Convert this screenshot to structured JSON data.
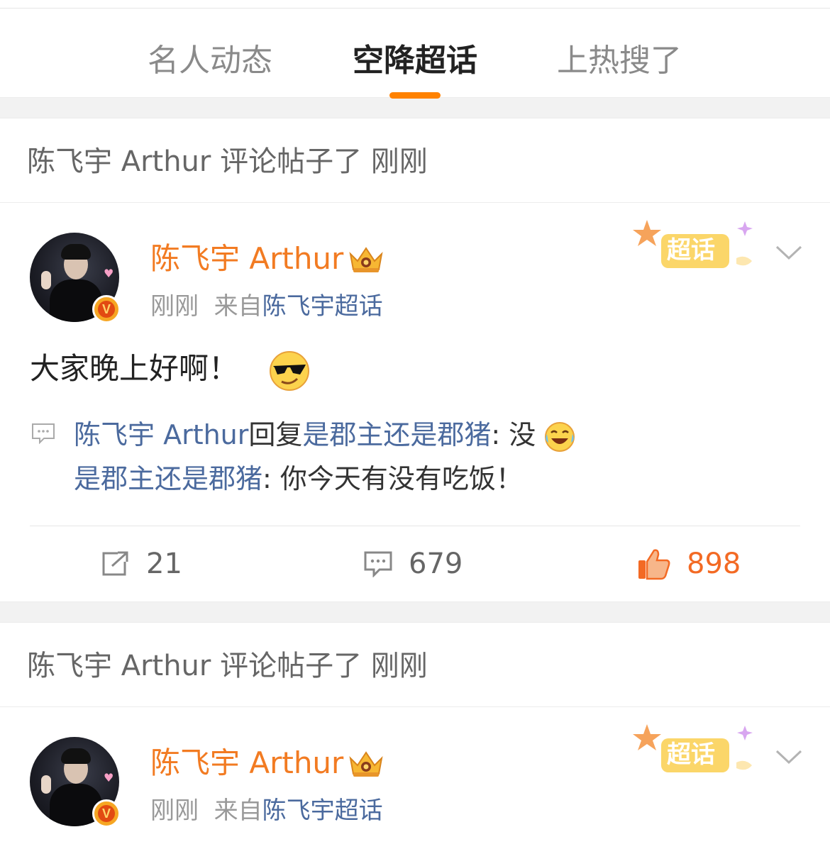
{
  "tabs": [
    {
      "label": "名人动态",
      "active": false
    },
    {
      "label": "空降超话",
      "active": true
    },
    {
      "label": "上热搜了",
      "active": false
    }
  ],
  "accent_color": "#ff8200",
  "posts": [
    {
      "notice": "陈飞宇 Arthur 评论帖子了  刚刚",
      "user": "陈飞宇 Arthur",
      "time": "刚刚",
      "from_prefix": "来自",
      "source": "陈飞宇超话",
      "badge_label": "超话",
      "text": "大家晚上好啊！",
      "text_emoji": "sunglasses-smirk-emoji",
      "reply_line1": {
        "user": "陈飞宇 Arthur",
        "verb": "回复",
        "target": "是郡主还是郡猪",
        "text": ": 没",
        "emoji": "laughing-crying-emoji"
      },
      "reply_line2": {
        "user": "是郡主还是郡猪",
        "text": ": 你今天有没有吃饭！"
      },
      "stats": {
        "reposts": "21",
        "comments": "679",
        "likes": "898"
      }
    },
    {
      "notice": "陈飞宇 Arthur 评论帖子了  刚刚",
      "user": "陈飞宇 Arthur",
      "time": "刚刚",
      "from_prefix": "来自",
      "source": "陈飞宇超话",
      "badge_label": "超话"
    }
  ]
}
